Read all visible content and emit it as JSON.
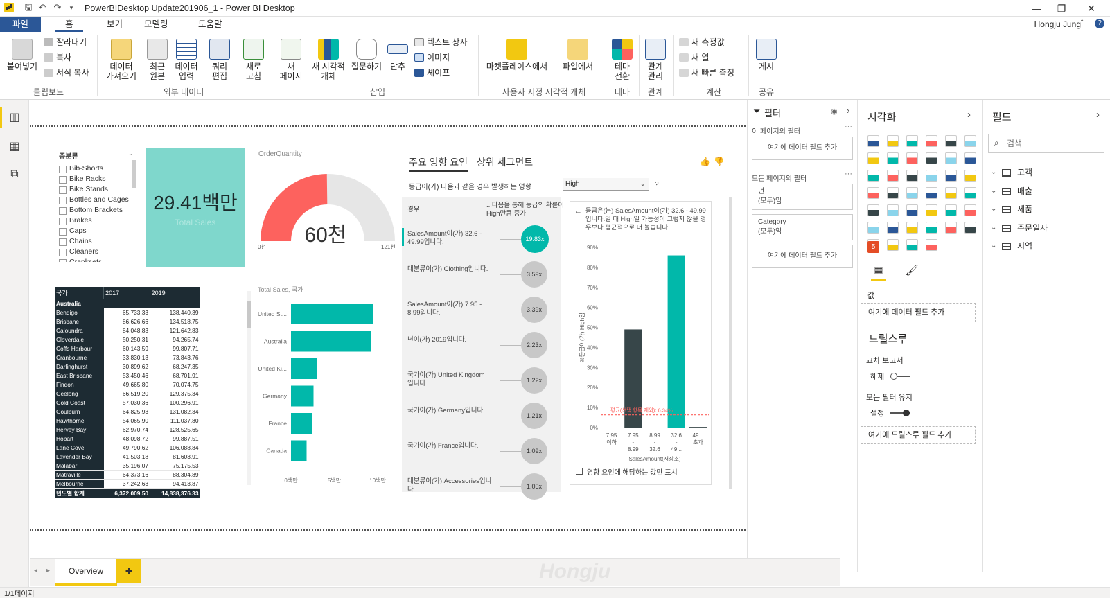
{
  "window": {
    "title": "PowerBIDesktop Update201906_1 - Power BI Desktop",
    "user": "Hongju Jung",
    "controls": [
      "—",
      "❐",
      "✕"
    ]
  },
  "ribbon_tabs": [
    "파일",
    "홈",
    "보기",
    "모델링",
    "도움말"
  ],
  "ribbon": {
    "clipboard": {
      "paste": "붙여넣기",
      "cut": "잘라내기",
      "copy": "복사",
      "format": "서식 복사",
      "label": "클립보드"
    },
    "external": {
      "get_data": [
        "데이터",
        "가져오기"
      ],
      "recent": [
        "최근",
        "원본"
      ],
      "enter": [
        "데이터",
        "입력"
      ],
      "edit": [
        "쿼리",
        "편집"
      ],
      "label": "외부 데이터"
    },
    "refresh": [
      "새로",
      "고침"
    ],
    "insert": {
      "new_page": [
        "새",
        "페이지"
      ],
      "new_visual": [
        "새 시각적",
        "개체"
      ],
      "qa": "질문하기",
      "buttons": "단추",
      "textbox": "텍스트 상자",
      "image": "이미지",
      "shapes": "셰이프",
      "label": "삽입"
    },
    "custom": {
      "market": "마켓플레이스에서",
      "file": "파일에서",
      "label": "사용자 지정 시각적 개체"
    },
    "theme": {
      "switch": [
        "테마",
        "전환"
      ],
      "label": "테마"
    },
    "relation": {
      "manage": [
        "관계",
        "관리"
      ],
      "label": "관계"
    },
    "calc": {
      "new_measure": "새 측정값",
      "new_column": "새 열",
      "quick_measure": "새 빠른 측정",
      "label": "계산"
    },
    "share": {
      "publish": "게시",
      "label": "공유"
    }
  },
  "slicer": {
    "title": "중분류",
    "items": [
      "Bib-Shorts",
      "Bike Racks",
      "Bike Stands",
      "Bottles and Cages",
      "Bottom Brackets",
      "Brakes",
      "Caps",
      "Chains",
      "Cleaners",
      "Cranksets"
    ]
  },
  "kpi": {
    "value": "29.41백만",
    "label": "Total Sales"
  },
  "gauge": {
    "title": "OrderQuantity",
    "value_text": "60천",
    "min": "0천",
    "max": "121천",
    "value": 60,
    "max_value": 121,
    "color": "#fd625e"
  },
  "table": {
    "headers": [
      "국가",
      "2017",
      "2019"
    ],
    "group": "Australia",
    "rows": [
      [
        "Bendigo",
        "65,733.33",
        "138,440.39"
      ],
      [
        "Brisbane",
        "86,626.66",
        "134,518.75"
      ],
      [
        "Caloundra",
        "84,048.83",
        "121,642.83"
      ],
      [
        "Cloverdale",
        "50,250.31",
        "94,265.74"
      ],
      [
        "Coffs Harbour",
        "60,143.59",
        "99,807.71"
      ],
      [
        "Cranbourne",
        "33,830.13",
        "73,843.76"
      ],
      [
        "Darlinghurst",
        "30,899.62",
        "68,247.35"
      ],
      [
        "East Brisbane",
        "53,450.46",
        "68,701.91"
      ],
      [
        "Findon",
        "49,665.80",
        "70,074.75"
      ],
      [
        "Geelong",
        "66,519.20",
        "129,375.34"
      ],
      [
        "Gold Coast",
        "57,030.36",
        "100,296.91"
      ],
      [
        "Goulburn",
        "64,825.93",
        "131,082.34"
      ],
      [
        "Hawthorne",
        "54,065.90",
        "111,037.80"
      ],
      [
        "Hervey Bay",
        "62,970.74",
        "128,525.65"
      ],
      [
        "Hobart",
        "48,098.72",
        "99,887.51"
      ],
      [
        "Lane Cove",
        "49,790.62",
        "106,088.84"
      ],
      [
        "Lavender Bay",
        "41,503.18",
        "81,603.91"
      ],
      [
        "Malabar",
        "35,196.07",
        "75,175.53"
      ],
      [
        "Matraville",
        "64,373.16",
        "88,304.89"
      ],
      [
        "Melbourne",
        "37,242.63",
        "94,413.87"
      ]
    ],
    "total": [
      "년도별 합계",
      "6,372,009.50",
      "14,838,376.33"
    ]
  },
  "bar_chart_title": "Total Sales, 국가",
  "chart_data": {
    "type": "bar",
    "orientation": "horizontal",
    "categories": [
      "United St...",
      "Australia",
      "United Ki...",
      "Germany",
      "France",
      "Canada"
    ],
    "values": [
      9.5,
      9.2,
      3.0,
      2.6,
      2.4,
      1.8
    ],
    "x_ticks": [
      "0백만",
      "5백만",
      "10백만"
    ],
    "xlim": [
      0,
      10
    ],
    "color": "#01b8aa"
  },
  "key_influencers": {
    "tab_main": "주요 영향 요인",
    "tab_segments": "상위 세그먼트",
    "question": "등급이(가) 다음과 같을 경우 발생하는 영향",
    "dropdown_value": "High",
    "help": "?",
    "col_when": "경우...",
    "col_likely": "...다음을 통해 등급의 확률이 High만큼 증가",
    "rows": [
      {
        "text": "SalesAmount이(가) 32.6 - 49.99입니다.",
        "value": "19.83x",
        "active": true
      },
      {
        "text": "대분류이(가) Clothing입니다.",
        "value": "3.59x",
        "active": false
      },
      {
        "text": "SalesAmount이(가) 7.95 - 8.99입니다.",
        "value": "3.39x",
        "active": false
      },
      {
        "text": "년이(가) 2019입니다.",
        "value": "2.23x",
        "active": false
      },
      {
        "text": "국가이(가) United Kingdom 입니다.",
        "value": "1.22x",
        "active": false
      },
      {
        "text": "국가이(가) Germany입니다.",
        "value": "1.21x",
        "active": false
      },
      {
        "text": "국가이(가) France입니다.",
        "value": "1.09x",
        "active": false
      },
      {
        "text": "대분류이(가) Accessories입니다.",
        "value": "1.05x",
        "active": false
      }
    ],
    "detail_text": "등급은(는) SalesAmount이(가) 32.6 - 49.99입니다.일 때 High일 가능성이 그렇지 않을 경우보다 평균적으로 더 높습니다",
    "detail_ylabel": "%등급이(가) High임",
    "detail_xlabel": "SalesAmount(저장소)",
    "detail_yticks": [
      "90%",
      "80%",
      "70%",
      "60%",
      "50%",
      "40%",
      "30%",
      "20%",
      "10%",
      "0%"
    ],
    "detail_categories": [
      "7.95 이하",
      "7.95 - 8.99",
      "8.99 - 32.6",
      "32.6 - 49...",
      "49... 초과"
    ],
    "detail_values": [
      0,
      49,
      0,
      86,
      0.3
    ],
    "avg_label": "평균(선택 항목 제외): 6.34%",
    "avg_value": 6.34,
    "show_only": "영향 요인에 해당하는 값만 표시"
  },
  "filters": {
    "title": "필터",
    "page_section": "이 페이지의 필터",
    "add_field": "여기에 데이터 필드 추가",
    "all_section": "모든 페이지의 필터",
    "f1_name": "년",
    "f1_val": "(모두)임",
    "f2_name": "Category",
    "f2_val": "(모두)임",
    "add_field2": "여기에 데이터 필드 추가"
  },
  "visualizations": {
    "title": "시각화",
    "values_label": "값",
    "add_field": "여기에 데이터 필드 추가",
    "drillthrough": "드릴스루",
    "cross_report": "교차 보고서",
    "cross_state": "해제",
    "keep_filters": "모든 필터 유지",
    "keep_state": "설정",
    "add_drill": "여기에 드릴스루 필드 추가"
  },
  "fields": {
    "title": "필드",
    "search_placeholder": "검색",
    "tables": [
      "고객",
      "매출",
      "제품",
      "주문일자",
      "지역"
    ]
  },
  "page_tab": "Overview",
  "add_page": "+",
  "status": "1/1페이지",
  "watermark": "Hongju"
}
